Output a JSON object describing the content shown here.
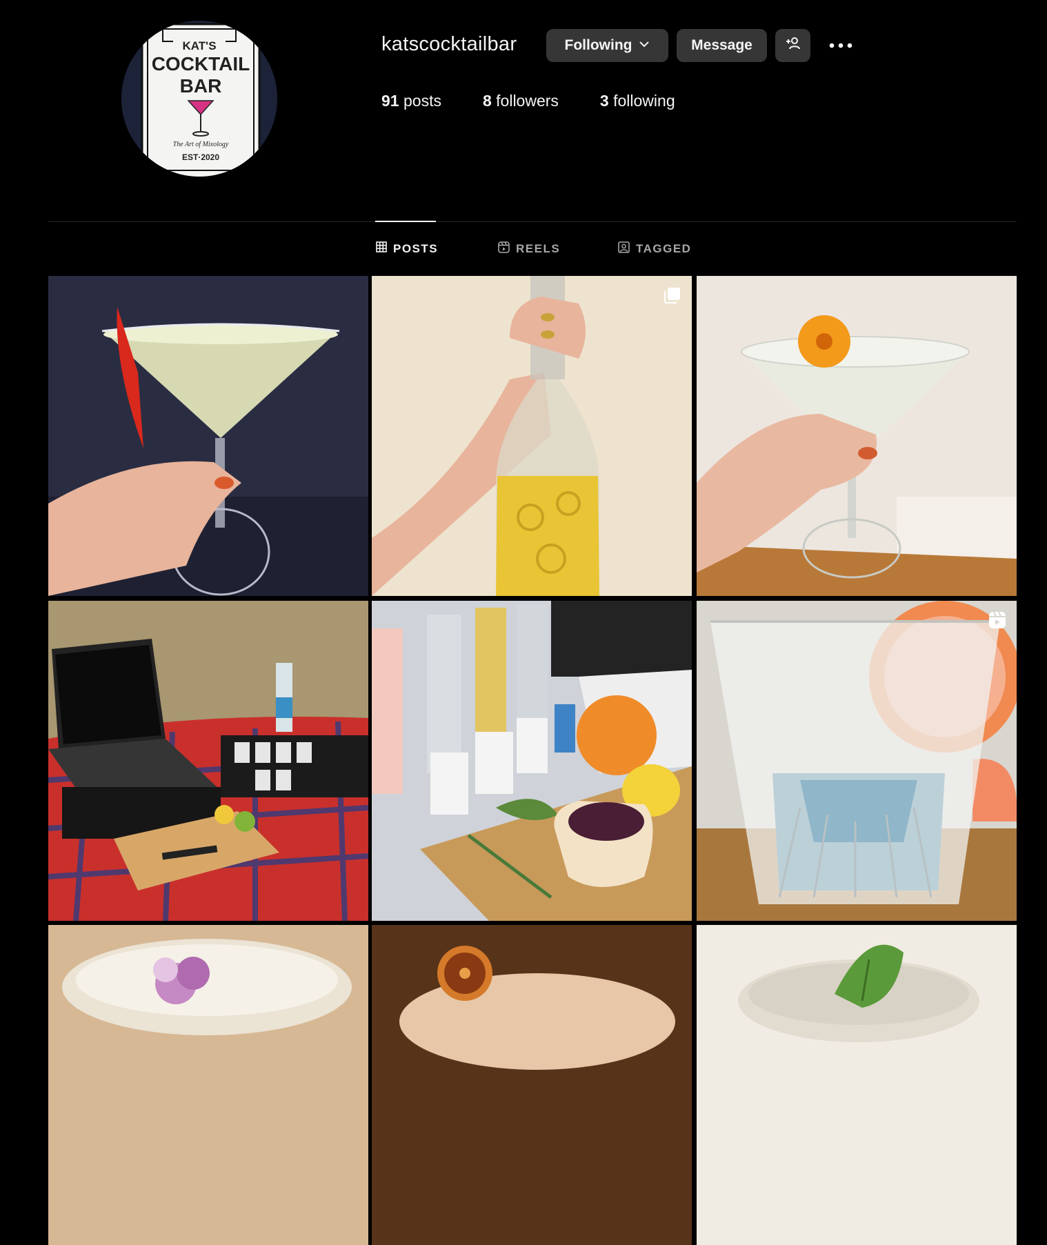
{
  "profile": {
    "username": "katscocktailbar",
    "avatar_alt": "Kat's Cocktail Bar logo",
    "stats": {
      "posts_count": "91",
      "posts_label": "posts",
      "followers_count": "8",
      "followers_label": "followers",
      "following_count": "3",
      "following_label": "following"
    }
  },
  "logo": {
    "line1": "KAT'S",
    "line2": "COCKTAIL",
    "line3": "BAR",
    "tagline": "The Art of Mixology",
    "est": "EST·2020"
  },
  "actions": {
    "following_label": "Following",
    "message_label": "Message",
    "add_user_icon": "add-user-icon",
    "more_icon": "more-dots-icon"
  },
  "tabs": [
    {
      "label": "POSTS",
      "icon": "grid-icon",
      "active": true
    },
    {
      "label": "REELS",
      "icon": "reels-icon",
      "active": false
    },
    {
      "label": "TAGGED",
      "icon": "tagged-icon",
      "active": false
    }
  ],
  "posts": [
    {
      "id": "post-1",
      "subject": "martini glass with red chili garnish",
      "badge": null
    },
    {
      "id": "post-2",
      "subject": "hand holding bottle of lemon infusion",
      "badge": "carousel-icon"
    },
    {
      "id": "post-3",
      "subject": "martini with orange marigold flower",
      "badge": null
    },
    {
      "id": "post-4",
      "subject": "laptop and gin tasting kit on tartan picnic blanket",
      "badge": null
    },
    {
      "id": "post-5",
      "subject": "tonic bottles, gin miniatures, grapefruit, lemon and berries",
      "badge": null
    },
    {
      "id": "post-6",
      "subject": "gin in crystal glass with grapefruit",
      "badge": "reel-icon"
    },
    {
      "id": "post-7",
      "subject": "cocktail with purple flower garnish",
      "badge": null
    },
    {
      "id": "post-8",
      "subject": "cocktail with dried orange wheel",
      "badge": null
    },
    {
      "id": "post-9",
      "subject": "cocktail with basil leaf",
      "badge": null
    }
  ],
  "colors": {
    "background": "#000000",
    "button_bg": "#363636",
    "text_primary": "#f5f5f5",
    "text_secondary": "#a8a8a8",
    "divider": "#262626"
  }
}
